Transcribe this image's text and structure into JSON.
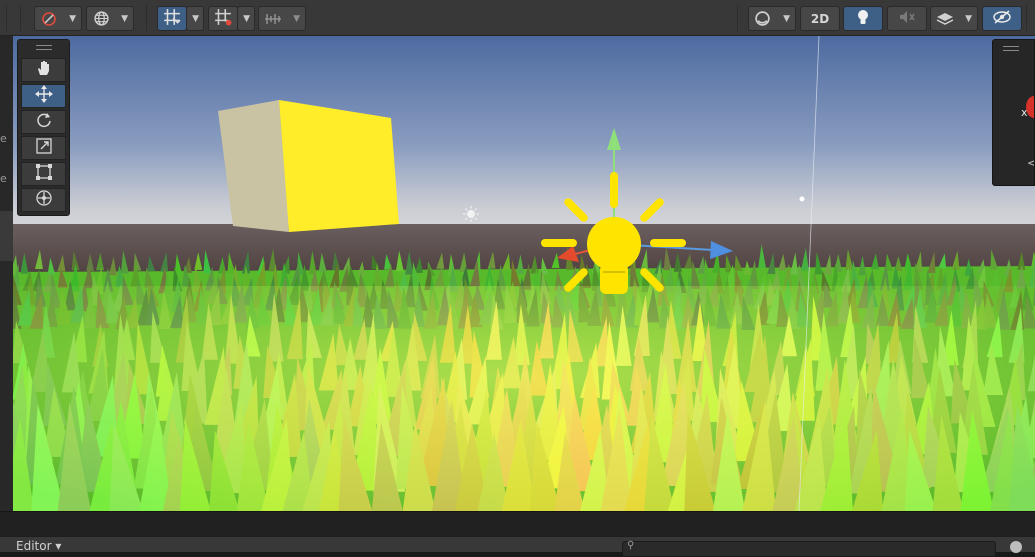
{
  "toolbar": {
    "mode_2d_label": "2D",
    "groups": [
      "gizmo-draw-mode",
      "global-local",
      "grid-snapping",
      "increment-snap",
      "snap-settings",
      "render-mode",
      "2d-toggle",
      "lighting",
      "audio",
      "effects",
      "scene-visibility"
    ]
  },
  "tools": {
    "items": [
      "hand-tool",
      "move-tool",
      "rotate-tool",
      "scale-tool",
      "rect-tool",
      "transform-tool"
    ],
    "active": "move-tool"
  },
  "gizmo": {
    "axis_label": "x",
    "back_glyph": "<"
  },
  "left_strip": {
    "chars": [
      "e",
      "e"
    ]
  },
  "bottom": {
    "editor_label": "Editor ▾",
    "search_glyph": "⚲"
  },
  "colors": {
    "toolbar_bg": "#383838",
    "active_blue": "#3e5f86",
    "sky_top": "#4e6aa0",
    "cube_yellow": "#ffed2a",
    "grass_green": "#62c92c",
    "light_gizmo": "#ffe400"
  }
}
